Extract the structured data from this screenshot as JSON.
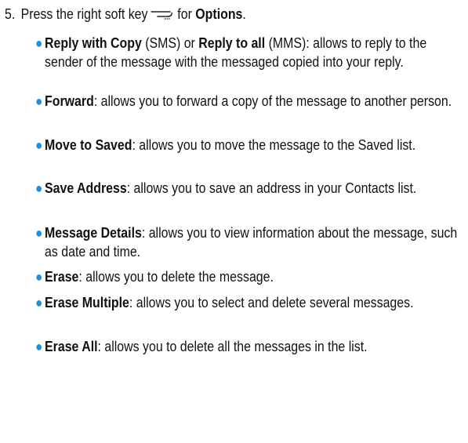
{
  "step": {
    "number": "5.",
    "before": "Press the right soft key",
    "after": "for",
    "term": "Options",
    "end": ".",
    "softkey_icon": "right-soft-key-icon"
  },
  "options": [
    {
      "term": "Reply with Copy",
      "mid1": " (SMS) or ",
      "term2": "Reply to all",
      "text": " (MMS): allows to reply to the sender of the message with the messaged copied into your reply."
    },
    {
      "term": "Forward",
      "text": ": allows you to forward a copy of the message to another person."
    },
    {
      "term": "Move to Saved",
      "text": ": allows you to move the message to the Saved list."
    },
    {
      "term": "Save Address",
      "text": ": allows you to save an address in your Contacts list."
    },
    {
      "term": "Message Details",
      "text": ": allows you to view information about the message, such as date and time."
    },
    {
      "term": "Erase",
      "text": ": allows you to delete the message."
    },
    {
      "term": "Erase Multiple",
      "text": ": allows you to select and delete several messages."
    },
    {
      "term": "Erase All",
      "text": ": allows you to delete all the messages in the list."
    }
  ],
  "colors": {
    "bullet": "#1e8fe0",
    "text": "#111111"
  }
}
